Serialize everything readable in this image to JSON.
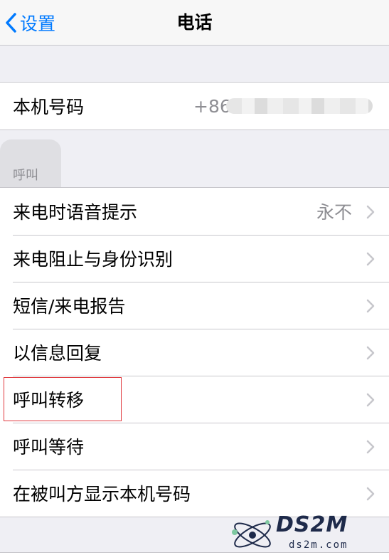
{
  "nav": {
    "back_label": "设置",
    "title": "电话"
  },
  "my_number": {
    "label": "本机号码",
    "value": "+86"
  },
  "calls_section": {
    "header": "呼叫",
    "items": [
      {
        "label": "来电时语音提示",
        "value": "永不"
      },
      {
        "label": "来电阻止与身份识别"
      },
      {
        "label": "短信/来电报告"
      },
      {
        "label": "以信息回复"
      },
      {
        "label": "呼叫转移"
      },
      {
        "label": "呼叫等待"
      },
      {
        "label": "在被叫方显示本机号码"
      }
    ]
  },
  "watermark": {
    "brand": "DS2M",
    "site": "ds2m.com"
  },
  "colors": {
    "accent": "#007aff",
    "highlight": "#e0393e",
    "secondary_text": "#8e8e93"
  }
}
